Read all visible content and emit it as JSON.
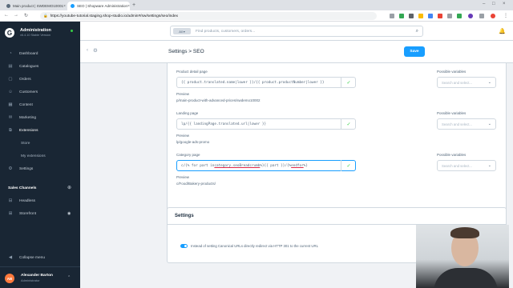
{
  "browser": {
    "tabs": [
      {
        "title": "Main product | SWDEMO10001",
        "active": false
      },
      {
        "title": "SEO | Shopware Administration",
        "active": true
      }
    ],
    "url": "https://youtube-tutorial.staging.shop-studio.io/admin#/sw/settings/seo/index"
  },
  "sidebar": {
    "app_title": "Administration",
    "app_version": "v6.4.10 Stable Version",
    "items": [
      {
        "label": "Dashboard",
        "icon": "dashboard-icon"
      },
      {
        "label": "Catalogues",
        "icon": "catalogues-icon"
      },
      {
        "label": "Orders",
        "icon": "orders-icon"
      },
      {
        "label": "Customers",
        "icon": "customers-icon"
      },
      {
        "label": "Content",
        "icon": "content-icon"
      },
      {
        "label": "Marketing",
        "icon": "marketing-icon"
      },
      {
        "label": "Extensions",
        "icon": "extensions-icon"
      },
      {
        "label": "Store",
        "icon": ""
      },
      {
        "label": "My extensions",
        "icon": ""
      },
      {
        "label": "Settings",
        "icon": "settings-icon"
      }
    ],
    "sales_channels_title": "Sales Channels",
    "sales_channels": [
      {
        "label": "Headless"
      },
      {
        "label": "Storefront"
      }
    ],
    "collapse_label": "Collapse menu",
    "user": {
      "initials": "AB",
      "name": "Alexander Barton",
      "role": "Administrator"
    }
  },
  "header": {
    "search_type": "All",
    "search_placeholder": "Find products, customers, orders..."
  },
  "smartbar": {
    "breadcrumb": "Settings > SEO",
    "save_label": "Save"
  },
  "seo": {
    "possible_variables_label": "Possible variables",
    "variables_placeholder": "Search and select...",
    "preview_label": "Preview",
    "fields": [
      {
        "label": "Product detail page",
        "template": "{{ product.translated.name|lower }}/{{ product.productNumber|lower }}",
        "preview": "p/main-product-with-advanced-prices/swdemo10002"
      },
      {
        "label": "Landing page",
        "template": "lp/{{ landingPage.translated.url|lower }}",
        "preview": "lp/google-ads-promo"
      },
      {
        "label": "Category page",
        "template_prefix": "c/{% for part in ",
        "template_mid1": "category.seoBreadcrumb",
        "template_mid2": " %}{{ part }}/{% ",
        "template_mid3": "endfor",
        "template_suffix": " %}",
        "preview": "c/Food/Bakery-products/"
      }
    ]
  },
  "settings": {
    "title": "Settings",
    "canonical_label": "Instead of setting Canonical URLs directly redirect via HTTP 301 to the current URL",
    "canonical_enabled": true
  },
  "colors": {
    "sidebar_bg": "#192634",
    "accent": "#189eff",
    "success": "#37d046"
  }
}
